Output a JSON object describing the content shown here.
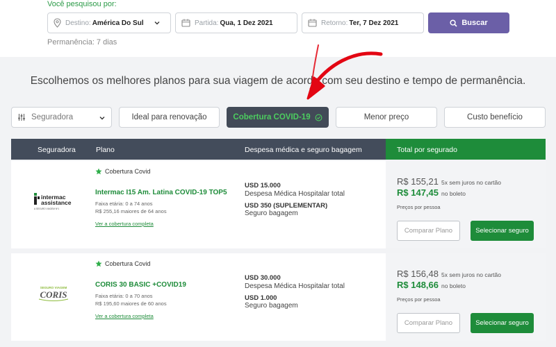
{
  "search": {
    "searched_label": "Você pesquisou por:",
    "destination_label": "Destino:",
    "destination_value": "América Do Sul",
    "departure_label": "Partida:",
    "departure_value": "Qua, 1 Dez 2021",
    "return_label": "Retorno:",
    "return_value": "Ter, 7 Dez 2021",
    "search_button": "Buscar",
    "stay": "Permanência: 7 dias"
  },
  "heading": "Escolhemos os melhores planos para sua viagem de acordo com seu destino e tempo de permanência.",
  "filters": {
    "insurer": "Seguradora",
    "renewal": "Ideal para renovação",
    "covid": "Cobertura COVID-19",
    "lowest_price": "Menor preço",
    "cost_benefit": "Custo benefício"
  },
  "table_header": {
    "insurer": "Seguradora",
    "plan": "Plano",
    "expenses": "Despesa médica e seguro bagagem",
    "total": "Total por segurado"
  },
  "plans": [
    {
      "logo": "intermac-assistance-logo",
      "logo_text": [
        "intermac",
        "assistance",
        "A SEGURO VIAGEM Nº1"
      ],
      "covid_tag": "Cobertura Covid",
      "name": "Intermac I15 Am. Latina COVID-19 TOP5",
      "age_range": "Faixa etária: 0 a 74 anos",
      "price_older": "R$ 255,16 maiores de 64 anos",
      "see_coverage": "Ver a cobertura completa",
      "medical_amount": "USD 15.000",
      "medical_label": "Despesa Médica Hospitalar total",
      "baggage_amount": "USD 350 (SUPLEMENTAR)",
      "baggage_label": "Seguro bagagem",
      "price_card": "R$ 155,21",
      "price_card_note": "5x sem juros no cartão",
      "price_boleto": "R$ 147,45",
      "price_boleto_note": "no boleto",
      "per_person": "Preços por pessoa",
      "compare_button": "Comparar Plano",
      "select_button": "Selecionar seguro"
    },
    {
      "logo": "coris-logo",
      "logo_text": [
        "SEGURO VIAGEM",
        "CORIS"
      ],
      "covid_tag": "Cobertura Covid",
      "name": "CORIS 30 BASIC +COVID19",
      "age_range": "Faixa etária: 0 a 70 anos",
      "price_older": "R$ 195,60 maiores de 60 anos",
      "see_coverage": "Ver a cobertura completa",
      "medical_amount": "USD 30.000",
      "medical_label": "Despesa Médica Hospitalar total",
      "baggage_amount": "USD 1.000",
      "baggage_label": "Seguro bagagem",
      "price_card": "R$ 156,48",
      "price_card_note": "5x sem juros no cartão",
      "price_boleto": "R$ 148,66",
      "price_boleto_note": "no boleto",
      "per_person": "Preços por pessoa",
      "compare_button": "Comparar Plano",
      "select_button": "Selecionar seguro"
    }
  ],
  "colors": {
    "brand_purple": "#6b5fa7",
    "green": "#1e8c3a",
    "dark_header": "#434c5b",
    "arrow_red": "#e30613"
  }
}
